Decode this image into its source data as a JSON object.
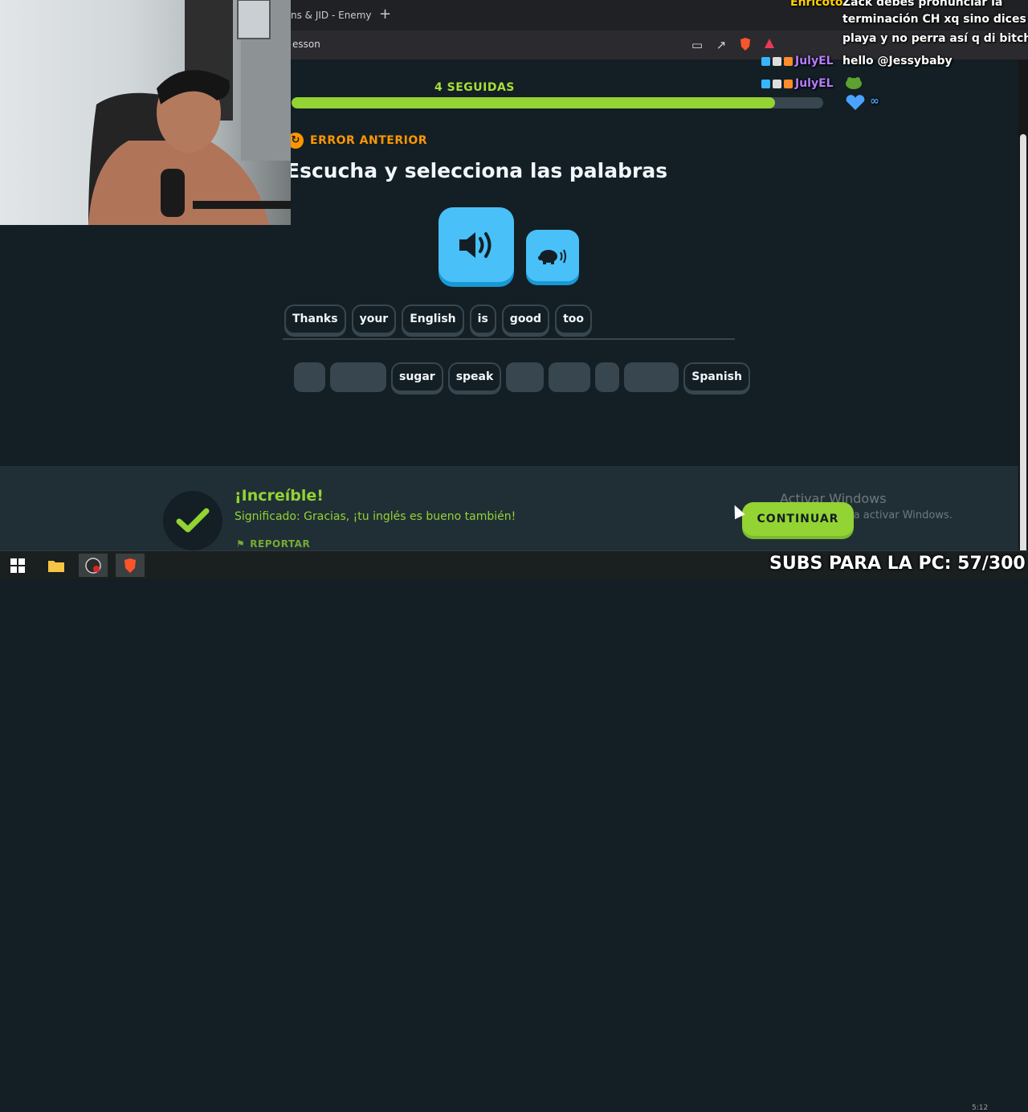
{
  "browser": {
    "tab_title": "ns & JID - Enemy",
    "new_tab_label": "+",
    "url": "esson"
  },
  "lesson": {
    "streak_label": "4 SEGUIDAS",
    "progress_percent": 91,
    "error_label": "ERROR ANTERIOR",
    "title": "Escucha y selecciona las palabras",
    "answer_words": [
      "Thanks",
      "your",
      "English",
      "is",
      "good",
      "too"
    ],
    "bank_words": {
      "sugar": "sugar",
      "speak": "speak",
      "spanish": "Spanish"
    }
  },
  "footer": {
    "result_title": "¡Increíble!",
    "meaning": "Significado: Gracias, ¡tu inglés es bueno también!",
    "report_label": "REPORTAR",
    "continue_label": "CONTINUAR",
    "activate_title": "Activar Windows",
    "activate_sub": "ción para activar Windows."
  },
  "overlay": {
    "subs_text": "SUBS PARA LA PC: 57/300",
    "clock_time": "5:12",
    "chat": [
      {
        "user": "Enricoto",
        "text": "Zack debes pronunciar la"
      },
      {
        "user": "",
        "text": "terminación CH xq sino dices"
      },
      {
        "user": "",
        "text": "playa y no perra así q di bitch"
      },
      {
        "user": "JulyEL",
        "text": "hello @Jessybaby"
      },
      {
        "user": "JulyEL",
        "text": ""
      }
    ]
  },
  "colors": {
    "background": "#131f24",
    "green": "#93d333",
    "blue": "#49c0f8",
    "orange": "#ff9600",
    "footer": "#202f36"
  }
}
